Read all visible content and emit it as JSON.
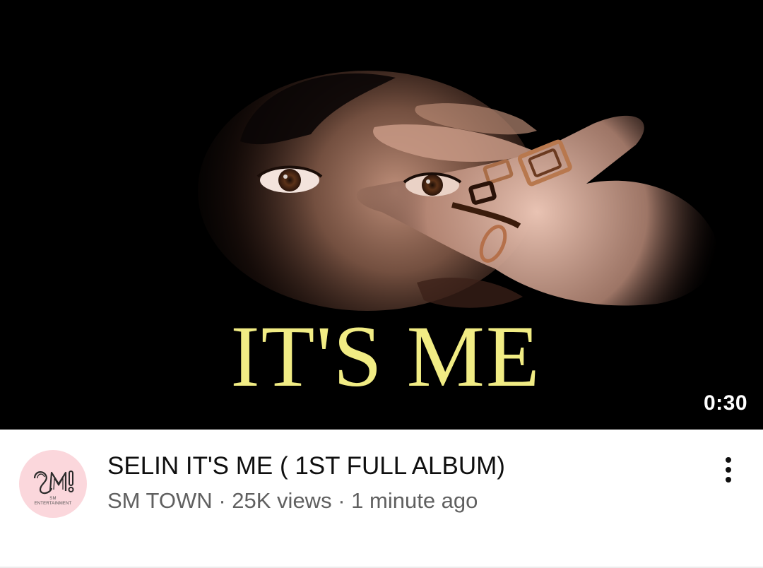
{
  "video": {
    "thumbnail_text": "IT'S ME",
    "duration": "0:30",
    "title": "SELIN IT'S ME ( 1ST FULL ALBUM)",
    "channel": "SM TOWN",
    "separator": "·",
    "views": "25K views",
    "age": "1 minute ago"
  },
  "avatar": {
    "icon": "sm-entertainment-logo",
    "caption_line1": "SM",
    "caption_line2": "ENTERTAINMENT"
  },
  "menu": {
    "icon": "more-vert-icon"
  },
  "colors": {
    "thumbnail_bg": "#000000",
    "thumbnail_text": "#f1ec84",
    "title_text": "#0f0f0f",
    "meta_text": "#606060",
    "avatar_bg": "#fbd7dc"
  }
}
